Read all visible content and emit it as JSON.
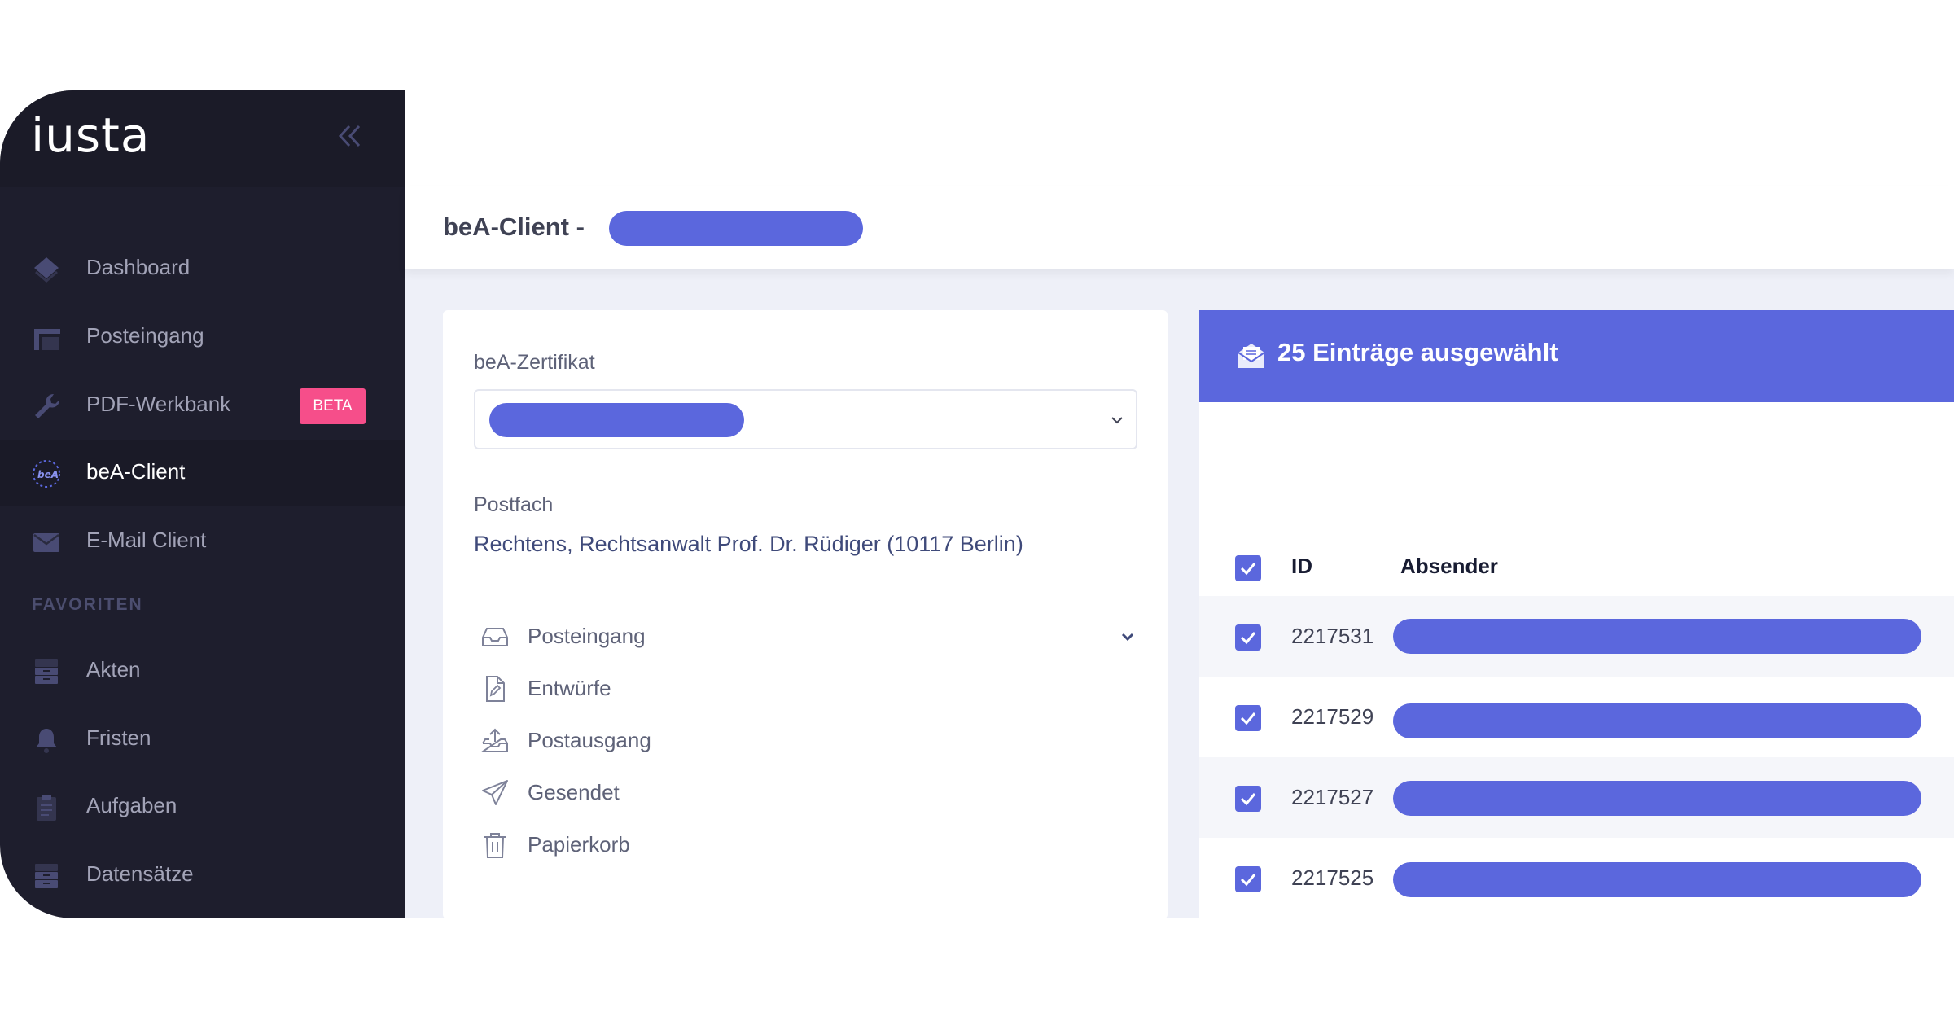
{
  "app": {
    "logo": "iusta"
  },
  "sidebar": {
    "items": [
      {
        "label": "Dashboard",
        "icon": "layers-icon"
      },
      {
        "label": "Posteingang",
        "icon": "inbox-tray-icon"
      },
      {
        "label": "PDF-Werkbank",
        "icon": "wrench-icon",
        "badge": "BETA"
      },
      {
        "label": "beA-Client",
        "icon": "bea-logo-icon",
        "active": true
      },
      {
        "label": "E-Mail Client",
        "icon": "envelope-icon"
      }
    ],
    "section_title": "FAVORITEN",
    "favorites": [
      {
        "label": "Akten",
        "icon": "cabinet-icon"
      },
      {
        "label": "Fristen",
        "icon": "bell-icon"
      },
      {
        "label": "Aufgaben",
        "icon": "clipboard-icon"
      },
      {
        "label": "Datensätze",
        "icon": "cabinet-icon"
      }
    ]
  },
  "subheader": {
    "title": "beA-Client -"
  },
  "left_panel": {
    "cert_label": "beA-Zertifikat",
    "postfach_label": "Postfach",
    "postfach_value": "Rechtens, Rechtsanwalt Prof. Dr. Rüdiger (10117 Berlin)",
    "folders": [
      {
        "label": "Posteingang",
        "icon": "inbox-icon",
        "expandable": true
      },
      {
        "label": "Entwürfe",
        "icon": "draft-file-icon"
      },
      {
        "label": "Postausgang",
        "icon": "outbox-icon"
      },
      {
        "label": "Gesendet",
        "icon": "paper-plane-icon"
      },
      {
        "label": "Papierkorb",
        "icon": "trash-icon"
      }
    ]
  },
  "right_panel": {
    "header": "25 Einträge ausgewählt",
    "columns": {
      "id": "ID",
      "sender": "Absender"
    },
    "rows": [
      {
        "id": "2217531",
        "checked": true
      },
      {
        "id": "2217529",
        "checked": true
      },
      {
        "id": "2217527",
        "checked": true
      },
      {
        "id": "2217525",
        "checked": true
      }
    ]
  },
  "colors": {
    "accent": "#5b67dd",
    "sidebar_bg": "#1e1e2d",
    "beta_badge": "#f64e8a"
  }
}
